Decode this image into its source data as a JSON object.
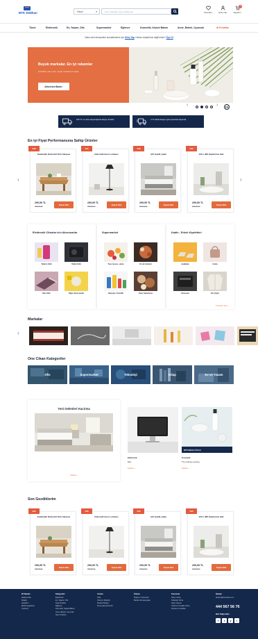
{
  "brand": {
    "name": "BTK Dükkan"
  },
  "search": {
    "category": "Hepsi",
    "placeholder": "Ürün, kategori veya marka ara..."
  },
  "header_icons": [
    {
      "label": "Favoriler",
      "icon": "heart-icon"
    },
    {
      "label": "Giriş Yap",
      "icon": "user-icon"
    },
    {
      "label": "Sepetim",
      "icon": "cart-icon",
      "count": "0"
    }
  ],
  "nav": {
    "items": [
      "Tümü",
      "Elektronik",
      "Ev, Yaşam, Ofis",
      "Supermarket",
      "Eğlence",
      "Kozmetik, Kişisel Bakım",
      "Anne, Bebek, Oyuncak"
    ],
    "highlight": "Fırsatlar"
  },
  "login_hint": {
    "pre": "Daha özel deneyimler sunabilmemiz için",
    "login": "Giriş Yap",
    "mid": ". Henüz müşterimiz değil misin?",
    "signup": "Üye Ol"
  },
  "hero": {
    "title": "Buyuk markalar. En iyi rakamlar",
    "subtitle": "100.000'e yakın ürün, büyük markalar bir arada",
    "button": "Alisverise Basla"
  },
  "carousel": {
    "prev": "‹",
    "next": "›"
  },
  "promos": [
    {
      "text": "100 TL ve üzeri alışverişlerde kargo ücretsiz",
      "icon": "truck-icon"
    },
    {
      "text": "4 TL farkla kargon gün içerisinde kapında",
      "icon": "fast-truck-icon"
    }
  ],
  "sections": {
    "best_title": "En iyi Fiyat Performansına Sahip Ürünler",
    "recent_title": "Son Gezdiklerim",
    "brands_title": "Markalar",
    "featured_title": "One Cikan Kategoriler"
  },
  "product_badge": "%36",
  "products": [
    {
      "name": "Kadanaldı Dekoratif Orta Sehpası",
      "price": "299,99 TL",
      "old": "459,00 TL",
      "button": "Sepete Ekle"
    },
    {
      "name": "Dekoratif Gece Lambası",
      "price": "299,99 TL",
      "old": "459,00 TL",
      "button": "Sepete Ekle"
    },
    {
      "name": "Çift kişilik yatak",
      "price": "299,99 TL",
      "old": "459,00 TL",
      "button": "Sepete Ekle"
    },
    {
      "name": "240 x 380 Kapitnmaz Hali",
      "price": "299,99 TL",
      "old": "459,00 TL",
      "button": "Sepete Ekle"
    }
  ],
  "category_cards": [
    {
      "title": "Elektronik Cihazlar icin Aksesuarlar",
      "cells": [
        "Telefon Kılıfı",
        "Tablet Kılıfı",
        "Mac Kılıfı",
        "Diger Aksesuarlar"
      ]
    },
    {
      "title": "Supermarket",
      "cells": [
        "Tuzu meyve, sebze",
        "Et süt ürünleri",
        "Deterjan, Temizlik",
        "Gıda, Şekerleme"
      ]
    },
    {
      "title": "Kadin - Erkek Kiyafetleri",
      "cells": [
        "Ayakkabı",
        "Canta",
        "Aksesuar",
        "Dış Giyim"
      ]
    }
  ],
  "more_link": "Tumunu Gor ›",
  "brands": [
    "brand-1",
    "brand-2",
    "brand-3",
    "brand-4",
    "brand-5",
    "brand-6"
  ],
  "featured": [
    "Ofis",
    "Supermarket",
    "Teknoloji",
    "Kitap",
    "Ev ve Yasam"
  ],
  "new_arrivals": {
    "title": "Yeni Gelenleri Kacirma",
    "link": "Kesfet »",
    "tiles": [
      {
        "name": "Elektronik",
        "sub": "Mac",
        "link": "Kesfet »"
      },
      {
        "name": "Kozmetik",
        "sub": "The ordinary peeling",
        "link": "Kesfet »",
        "tag": "BTK Market Ürünü"
      }
    ]
  },
  "footer": {
    "columns": [
      {
        "title": "BT Market",
        "items": [
          "Hakkımızda",
          "İletişim",
          "Hesabım",
          "Mobil Uygulama",
          "Yardımcı"
        ]
      },
      {
        "title": "Kategoriler",
        "items": [
          "Elektronik",
          "Ev, Yaşam, Ofis",
          "Supermarket",
          "Eğlence",
          "Kozmetik, Kişisel Bakım",
          "Anne, Bebek, Oyuncak",
          "Spor Outdoor"
        ]
      },
      {
        "title": "Yardım",
        "items": [
          "SSS",
          "Üzerum Merkezi",
          "Destek İletişim",
          "Kurumsal Çözümler"
        ]
      },
      {
        "title": "Ödeme",
        "items": [
          "Ödeme Yöntemleri",
          "Banka Kampanyaları"
        ]
      },
      {
        "title": "Kurumsal",
        "items": [
          "Satıcı Olma",
          "Tedarikçi Olma",
          "Satış Yapma",
          "Yasal ve Kurallar Olma",
          "Donanım Kuralları"
        ]
      }
    ],
    "contact_title": "İletişim",
    "email": "iletisim@btmarket.com",
    "phone": "444 567 56 76",
    "follow": "Bizi Takip Edin",
    "social": [
      "f",
      "t",
      "y",
      "i"
    ]
  },
  "colors": {
    "navy": "#14284b",
    "accent": "#e26a3d",
    "badge": "#e45a3d",
    "link": "#1d57b8"
  }
}
